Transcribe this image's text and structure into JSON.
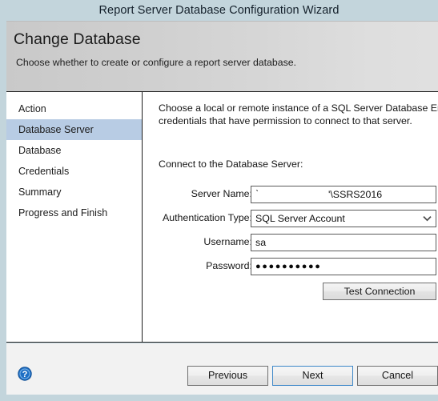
{
  "window": {
    "title": "Report Server Database Configuration Wizard"
  },
  "header": {
    "title": "Change Database",
    "subtitle": "Choose whether to create or configure a report server database."
  },
  "sidebar": {
    "items": [
      {
        "label": "Action",
        "selected": false
      },
      {
        "label": "Database Server",
        "selected": true
      },
      {
        "label": "Database",
        "selected": false
      },
      {
        "label": "Credentials",
        "selected": false
      },
      {
        "label": "Summary",
        "selected": false
      },
      {
        "label": "Progress and Finish",
        "selected": false
      }
    ]
  },
  "content": {
    "intro": "Choose a local or remote instance of a SQL Server Database Engine and",
    "intro_line2": "credentials that have permission to connect to that server.",
    "section_label": "Connect to the Database Server:",
    "fields": {
      "server_name": {
        "label": "Server Name:",
        "value_prefix": "ˋ",
        "value_suffix": "'\\SSRS2016"
      },
      "authentication_type": {
        "label": "Authentication Type:",
        "value": "SQL Server Account",
        "options": [
          "SQL Server Account"
        ]
      },
      "username": {
        "label": "Username:",
        "value": "sa"
      },
      "password": {
        "label": "Password:",
        "value": "●●●●●●●●●●"
      }
    },
    "test_connection_label": "Test Connection"
  },
  "footer": {
    "previous_label": "Previous",
    "next_label": "Next",
    "cancel_label": "Cancel"
  },
  "colors": {
    "titlebar": "#c3d5dc",
    "selection": "#b8cce4",
    "focus_border": "#3c87c8",
    "help_icon": "#1f6fc4"
  }
}
